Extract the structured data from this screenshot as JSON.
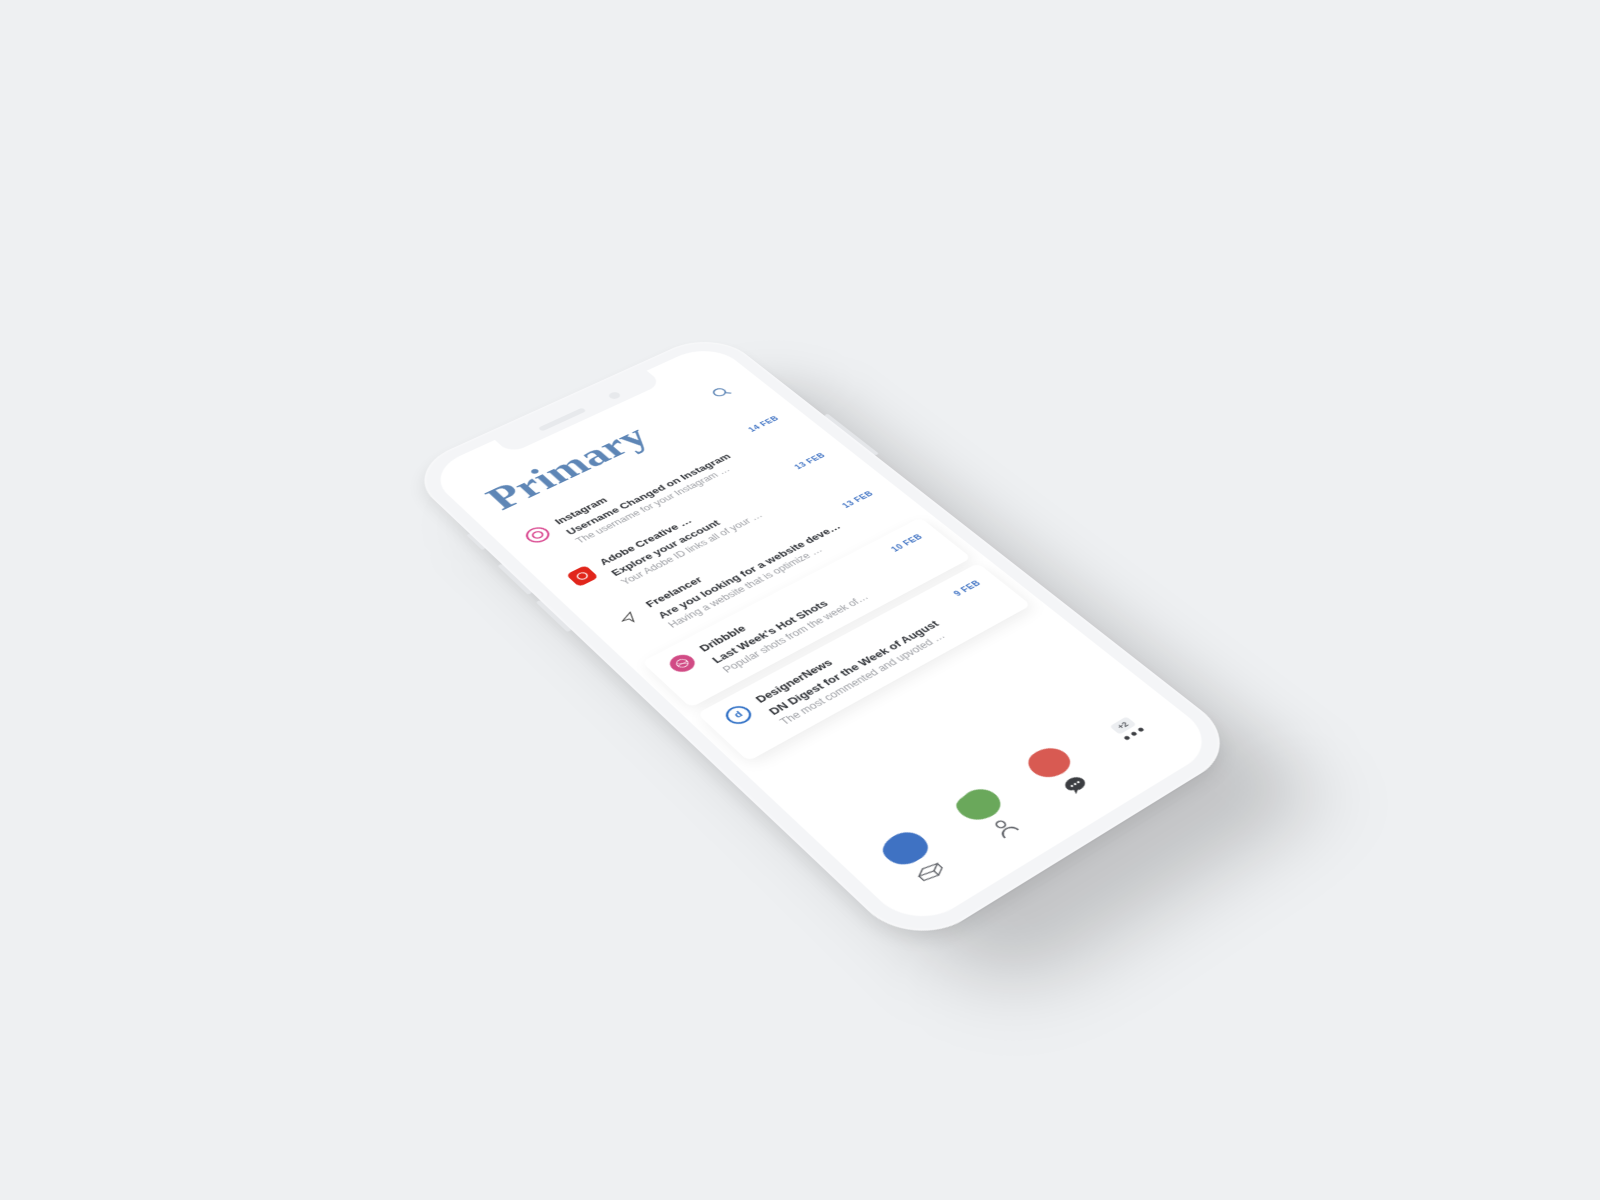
{
  "header": {
    "title": "Primary",
    "search_icon": "search"
  },
  "messages": [
    {
      "sender": "Instagram",
      "date": "14 FEB",
      "subject": "Username Changed on Instagram",
      "preview": "The username for your Instagram …",
      "icon": "ig"
    },
    {
      "sender": "Adobe Creative …",
      "date": "13 FEB",
      "subject": "Explore your account",
      "preview": "Your Adobe ID links all of your …",
      "icon": "adobe"
    },
    {
      "sender": "Freelancer",
      "date": "13 FEB",
      "subject": "Are you looking for a website deve…",
      "preview": "Having a website that is optimize …",
      "icon": "fl"
    },
    {
      "sender": "Dribbble",
      "date": "10 FEB",
      "subject": "Last Week's Hot Shots",
      "preview": "Popular shots from the week of…",
      "icon": "dr",
      "elevated": true
    },
    {
      "sender": "DesignerNews",
      "date": "9 FEB",
      "subject": "DN Digest for the Week of August",
      "preview": "The most commented and upvoted …",
      "icon": "dn",
      "elevated": true
    }
  ],
  "tabs": {
    "inbox_color": "#3f72c3",
    "social_color": "#6aa85b",
    "promo_color": "#d85a52",
    "more_badge": "+2"
  }
}
